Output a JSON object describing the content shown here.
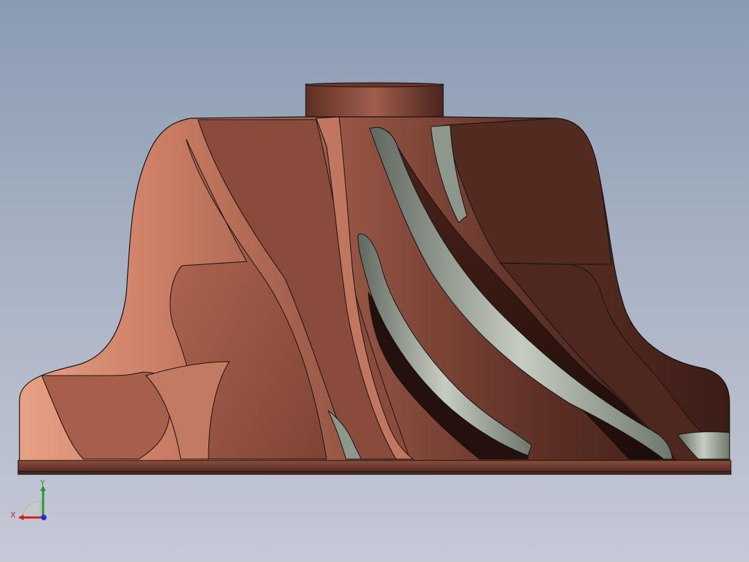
{
  "viewport": {
    "background_top": "#8a9bb1",
    "background_bottom": "#c6c9d6"
  },
  "model": {
    "part": "impeller",
    "body_color": "#9a5a48",
    "highlight_color": "#dc9278",
    "shadow_color": "#3d1e17",
    "blade_edge_color": "#8d978c"
  },
  "triad": {
    "x_label": "X",
    "y_label": "Y",
    "x_color": "#d21a1a",
    "y_color": "#1a9a2a",
    "z_color": "#2a2ad8"
  }
}
